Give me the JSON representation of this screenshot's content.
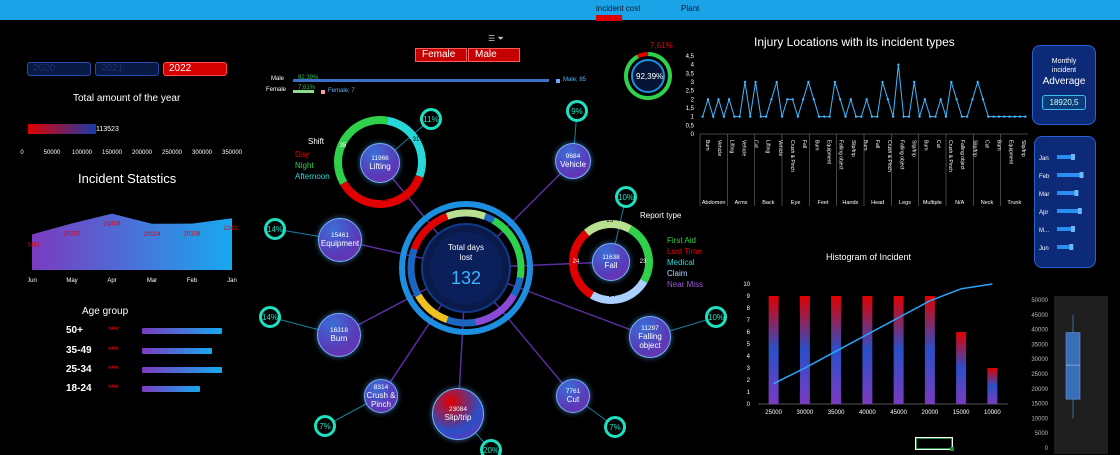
{
  "tabs": {
    "active": "incident cost",
    "other": "Plant"
  },
  "years": [
    "2020",
    "2021",
    "2022"
  ],
  "gender_buttons": [
    "Female",
    "Male"
  ],
  "gender_bars": {
    "male_label": "Male",
    "female_label": "Female",
    "male_pct": "92,39%",
    "female_pct": "7,61%",
    "male_value": "Male; 85",
    "female_value": "Female; 7"
  },
  "total_year": {
    "title": "Total amount of the year",
    "value": "113523",
    "fraction": 0.324,
    "ticks": [
      "0",
      "50000",
      "100000",
      "150000",
      "200000",
      "250000",
      "300000",
      "350000"
    ]
  },
  "stats": {
    "title": "Incident Statstics",
    "values": [
      "15461",
      "20202",
      "24408",
      "20024",
      "20108",
      "22432"
    ],
    "months": [
      "Jun",
      "May",
      "Apr",
      "Mar",
      "Feb",
      "Jan"
    ]
  },
  "age": {
    "title": "Age group",
    "stars": "****",
    "groups": [
      {
        "label": "50+",
        "fraction": 0.91
      },
      {
        "label": "35-49",
        "fraction": 0.8
      },
      {
        "label": "25-34",
        "fraction": 0.91
      },
      {
        "label": "18-24",
        "fraction": 0.66
      }
    ]
  },
  "gauge": {
    "top_pct": "7,61%",
    "main_pct": "92,39%",
    "fraction": 0.9239
  },
  "center": {
    "title1": "Total days",
    "title2": "lost",
    "value": "132"
  },
  "shift": {
    "title": "Shift",
    "labels": [
      "Day",
      "Night",
      "Afternoon"
    ]
  },
  "report": {
    "title": "Report type",
    "labels": [
      "First Aid",
      "Lost Time",
      "Medical",
      "Claim",
      "Near Miss"
    ],
    "ring_values": [
      "23",
      "24",
      "23",
      "24",
      "21"
    ]
  },
  "bubbles": [
    {
      "key": "lifting",
      "value": "11966",
      "name": "Lifting",
      "pct": "11%",
      "ring": [
        "35",
        "31",
        "36"
      ]
    },
    {
      "key": "vehicle",
      "value": "9684",
      "name": "Vehicle",
      "pct": "9%"
    },
    {
      "key": "equipment",
      "value": "15461",
      "name": "Equipment",
      "pct": "14%"
    },
    {
      "key": "fall",
      "value": "11638",
      "name": "Fall",
      "pct": "10%"
    },
    {
      "key": "burn",
      "value": "16318",
      "name": "Burn",
      "pct": "14%"
    },
    {
      "key": "falling-object",
      "value": "11297",
      "name": "Falling object",
      "pct": "10%"
    },
    {
      "key": "crush-pinch",
      "value": "8314",
      "name": "Crush & Pinch",
      "pct": "7%"
    },
    {
      "key": "cut",
      "value": "7761",
      "name": "Cut",
      "pct": "7%"
    },
    {
      "key": "slip-trip",
      "value": "23084",
      "name": "Slip/trip",
      "pct": "20%"
    }
  ],
  "injury_chart": {
    "title": "Injury Locations with its incident types",
    "yticks": [
      "0",
      "0,5",
      "1",
      "1,5",
      "2",
      "2,5",
      "3",
      "3,5",
      "4",
      "4,5"
    ],
    "groups": [
      "Abdomen",
      "Arms",
      "Back",
      "Eye",
      "Feet",
      "Hands",
      "Head",
      "Legs",
      "Multiple",
      "N/A",
      "Neck",
      "Trunk"
    ]
  },
  "chart_data": [
    {
      "type": "line",
      "title": "Injury Locations with its incident types",
      "ylim": [
        0,
        4.5
      ],
      "categories": [
        "Burn",
        "Vehicle",
        "Lifting",
        "Vehicle",
        "Cut",
        "Lifting",
        "Vehicle",
        "Crush & Pinch",
        "Fall",
        "Burn",
        "Equipment",
        "Falling object",
        "Slip/trip",
        "Burn",
        "Fall",
        "Crush & Pinch",
        "Falling object",
        "Slip/trip",
        "Burn",
        "Cut",
        "Crush & Pinch",
        "Falling object",
        "Slip/trip",
        "Cut",
        "Burn",
        "Equipment",
        "Slip/trip"
      ],
      "values": [
        1,
        2,
        1,
        2,
        1,
        2,
        1,
        1,
        3,
        1,
        3,
        1,
        1,
        2,
        3,
        1,
        2,
        2,
        1,
        2,
        3,
        2,
        1,
        1,
        1,
        3,
        2,
        1,
        2,
        1,
        1,
        2,
        1,
        1,
        3,
        2,
        1,
        4,
        1,
        1,
        3,
        1,
        2,
        1,
        1,
        2,
        1,
        3,
        2,
        1,
        1,
        2,
        3,
        2,
        1,
        1,
        1,
        1,
        1,
        1,
        1,
        1
      ]
    },
    {
      "type": "bar",
      "title": "Histogram of Incident",
      "ylim": [
        0,
        10
      ],
      "categories": [
        "25000",
        "30000",
        "35000",
        "40000",
        "45000",
        "20000",
        "15000",
        "10000"
      ],
      "values": [
        9,
        9,
        9,
        9,
        9,
        9,
        6,
        3
      ],
      "cumulative": [
        1.7,
        3.0,
        4.4,
        5.8,
        7.2,
        8.6,
        9.6,
        10.0
      ],
      "yticks": [
        "0",
        "1",
        "2",
        "3",
        "4",
        "5",
        "6",
        "7",
        "8",
        "9",
        "10"
      ]
    },
    {
      "type": "bar",
      "title": "Monthly incident Adverage",
      "categories": [
        "Jan",
        "Feb",
        "Mar",
        "Apr",
        "M...",
        "Jun"
      ],
      "values": [
        0.5,
        0.75,
        0.6,
        0.7,
        0.5,
        0.45
      ]
    },
    {
      "type": "box",
      "yticks": [
        "0",
        "5000",
        "10000",
        "15000",
        "20000",
        "25000",
        "30000",
        "35000",
        "40000",
        "45000",
        "50000"
      ],
      "min": 10000,
      "q1": 16500,
      "median": 28000,
      "q3": 39000,
      "max": 45000
    }
  ],
  "monthly": {
    "line1": "Monthly",
    "line2": "incident",
    "line3": "Adverage",
    "value": "18920,5"
  }
}
